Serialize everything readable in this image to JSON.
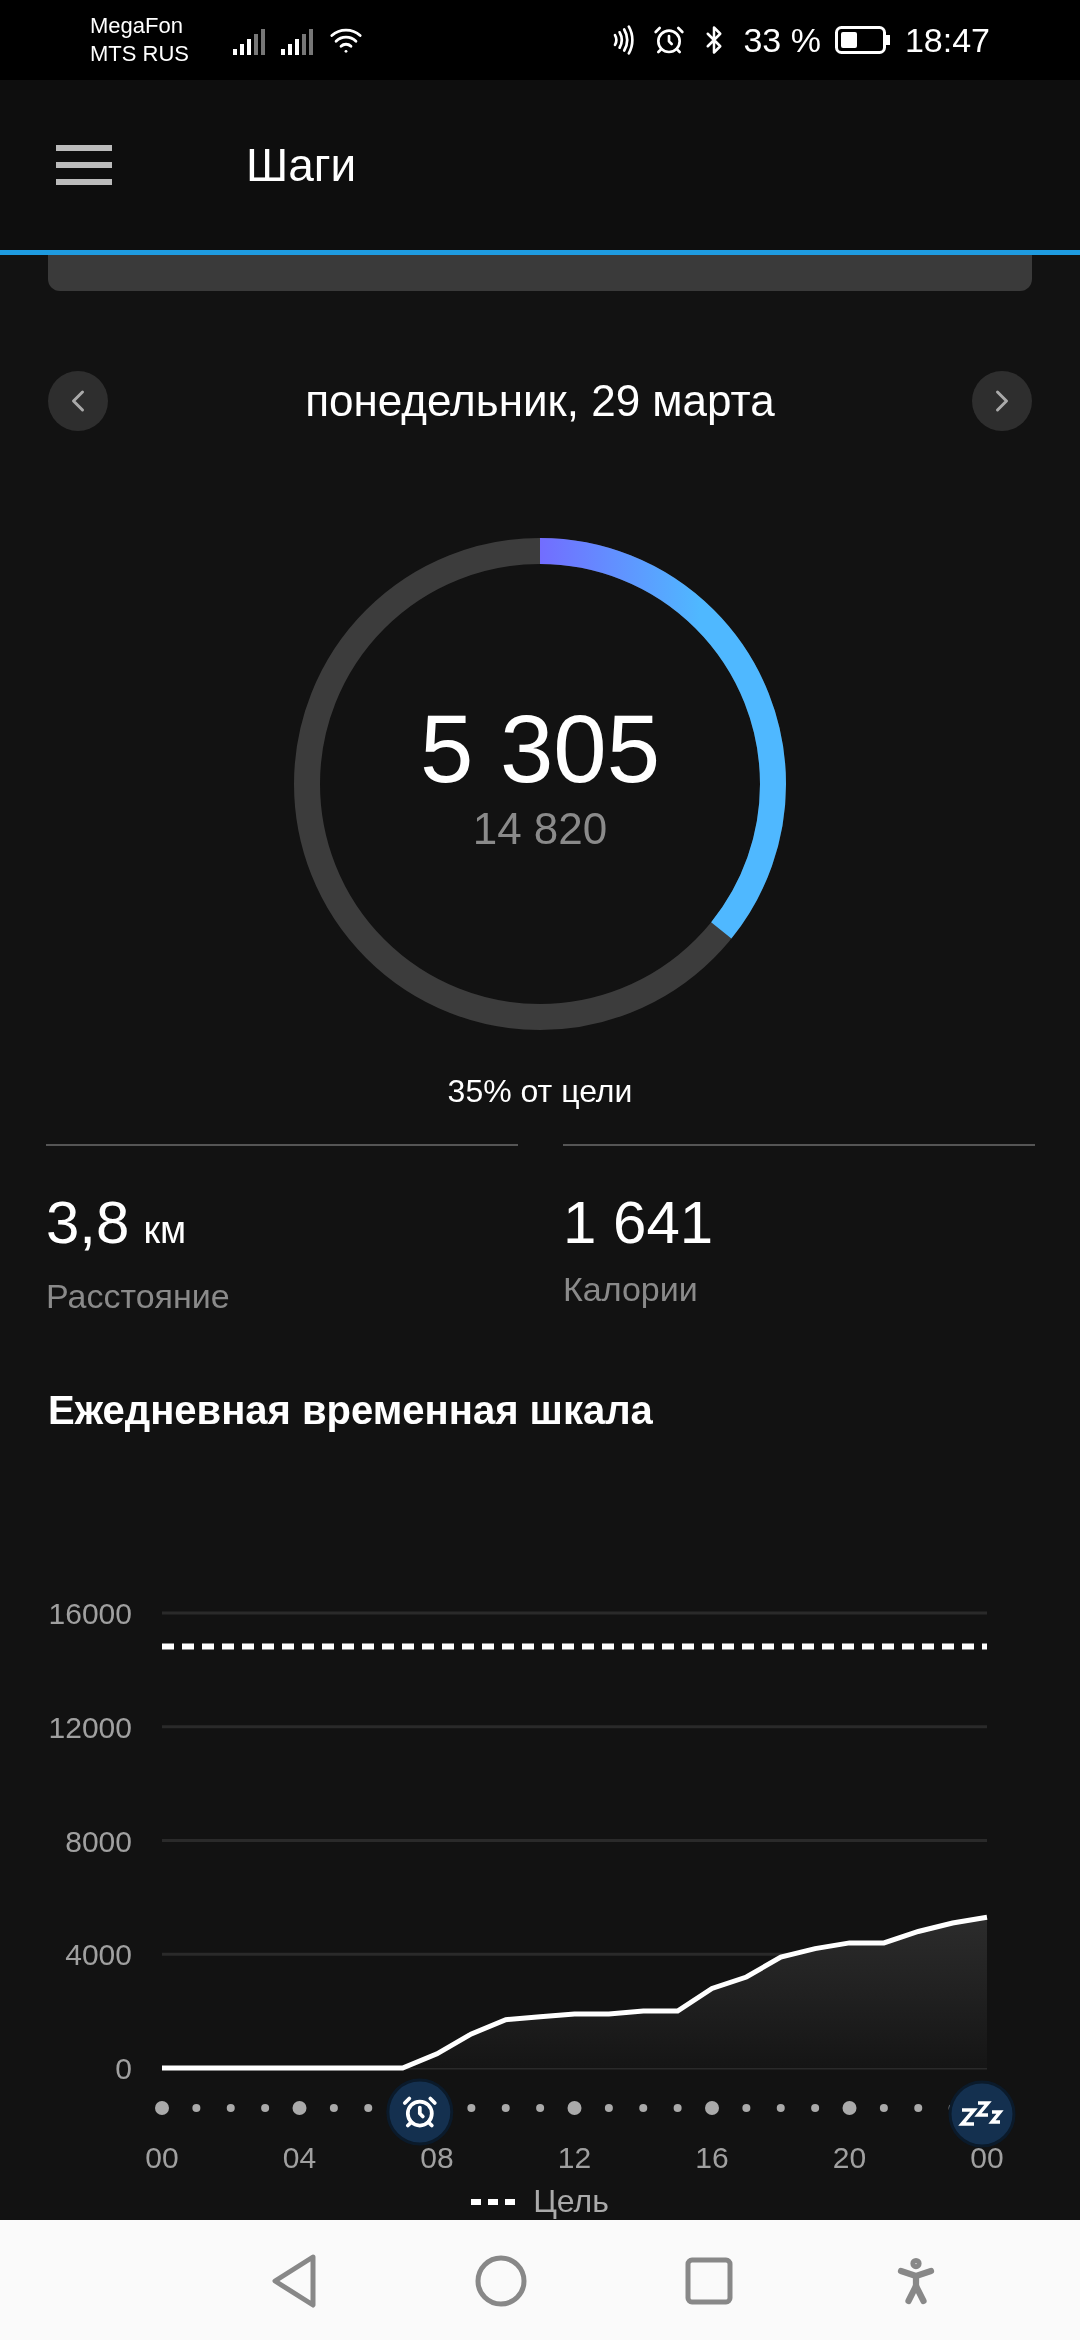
{
  "status_bar": {
    "carriers": [
      "MegaFon",
      "MTS RUS"
    ],
    "battery": "33 %",
    "time": "18:47"
  },
  "app_bar": {
    "title": "Шаги"
  },
  "date_nav": {
    "date": "понедельник, 29 марта"
  },
  "ring": {
    "steps": "5 305",
    "goal": "14 820",
    "level": 0.358,
    "caption": "35% от цели"
  },
  "stats": [
    {
      "value": "3,8",
      "unit": "км",
      "label": "Расстояние"
    },
    {
      "value": "1 641",
      "label": "Калории"
    }
  ],
  "timeline": {
    "title": "Ежедневная временная шкала",
    "chart_data": {
      "type": "area",
      "x": [
        0,
        1,
        2,
        3,
        4,
        5,
        6,
        7,
        8,
        9,
        10,
        11,
        12,
        13,
        14,
        15,
        16,
        17,
        18,
        19,
        20,
        21,
        22,
        23,
        24
      ],
      "series": [
        {
          "color": "#ffffff",
          "values": [
            0,
            0,
            0,
            0,
            0,
            0,
            0,
            0,
            500,
            1200,
            1700,
            1800,
            1900,
            1900,
            2000,
            2000,
            2800,
            3200,
            3900,
            4200,
            4400,
            4400,
            4800,
            5100,
            5300
          ]
        }
      ],
      "xlim": [
        0,
        24
      ],
      "ylim": [
        0,
        16000
      ],
      "yticks": [
        0,
        4000,
        8000,
        12000,
        16000
      ],
      "grid": true,
      "xticks": [
        {
          "value": 0,
          "label": "00"
        },
        {
          "value": 4,
          "label": "04"
        },
        {
          "value": 8,
          "label": "08"
        },
        {
          "value": 12,
          "label": "12"
        },
        {
          "value": 16,
          "label": "16"
        },
        {
          "value": 20,
          "label": "20"
        },
        {
          "value": 24,
          "label": "00"
        }
      ],
      "ref_lines": [
        {
          "axis": "y",
          "value": 14820
        }
      ]
    },
    "markers": [
      {
        "kind": "wake"
      },
      {
        "kind": "sleep"
      }
    ],
    "legend": {
      "label": "Цель"
    }
  }
}
